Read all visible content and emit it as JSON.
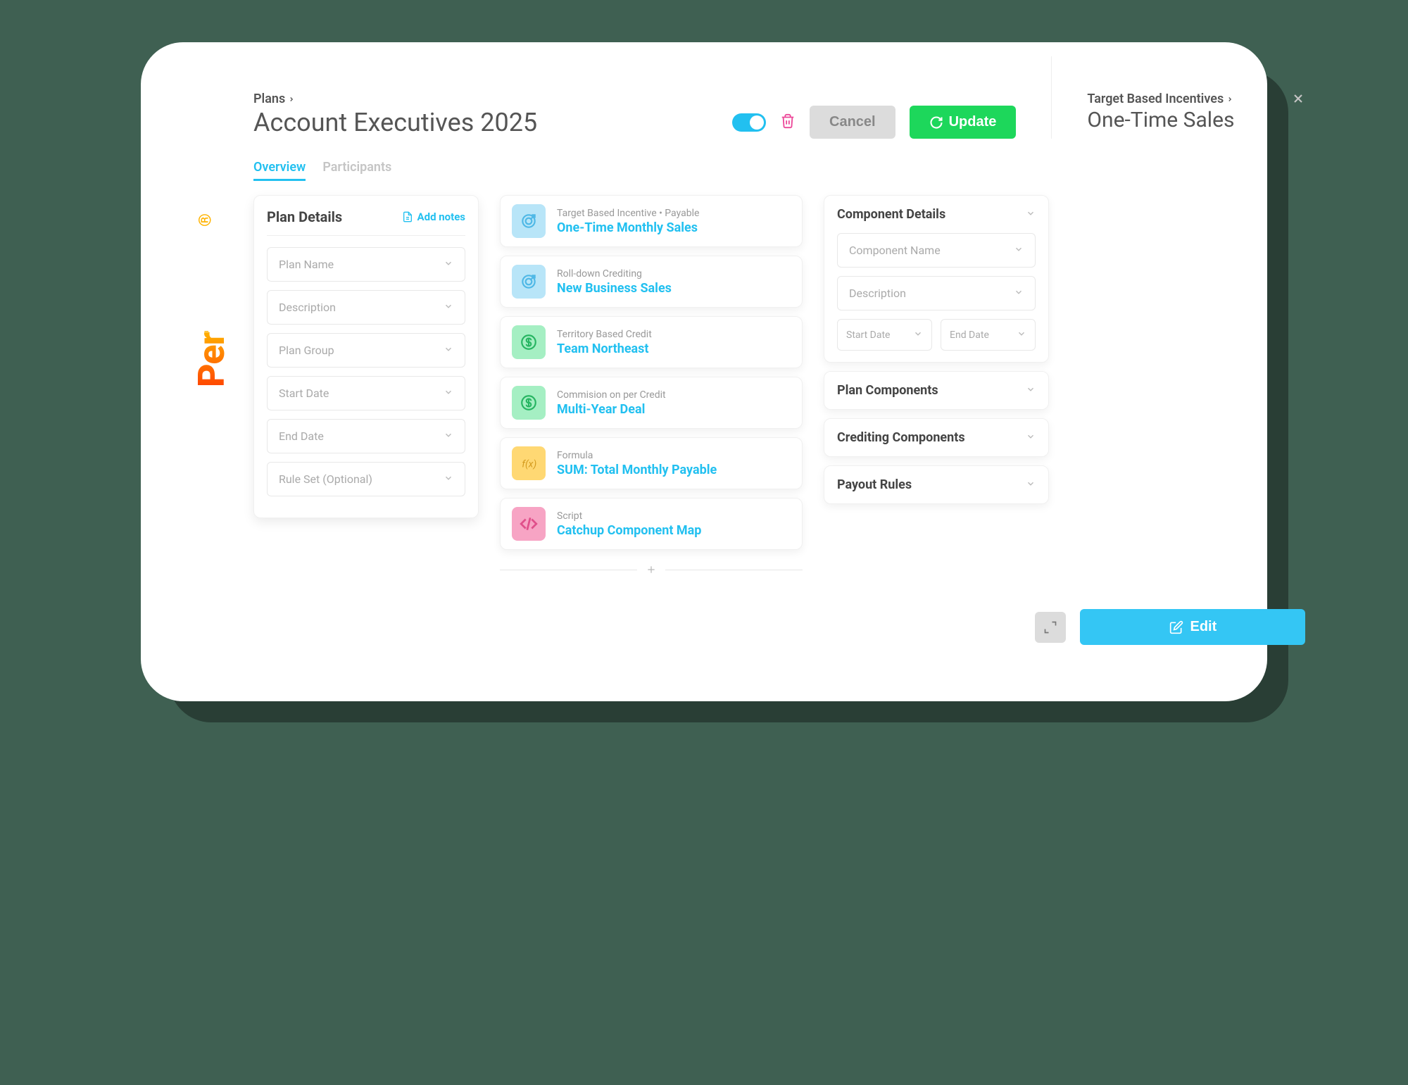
{
  "brand": "Performio",
  "breadcrumb": {
    "root": "Plans"
  },
  "title": "Account Executives 2025",
  "actions": {
    "cancel": "Cancel",
    "update": "Update"
  },
  "tabs": [
    {
      "label": "Overview",
      "active": true
    },
    {
      "label": "Participants",
      "active": false
    }
  ],
  "planDetails": {
    "heading": "Plan Details",
    "addNotes": "Add notes",
    "fields": [
      {
        "label": "Plan Name",
        "optional": ""
      },
      {
        "label": "Description",
        "optional": ""
      },
      {
        "label": "Plan Group",
        "optional": ""
      },
      {
        "label": "Start Date",
        "optional": ""
      },
      {
        "label": "End Date",
        "optional": ""
      },
      {
        "label": "Rule Set",
        "optional": "(Optional)"
      }
    ]
  },
  "components": [
    {
      "meta": "Target Based Incentive • Payable",
      "name": "One-Time Monthly Sales",
      "icon": "target",
      "bg": "bg-blue"
    },
    {
      "meta": "Roll-down Crediting",
      "name": "New Business Sales",
      "icon": "target",
      "bg": "bg-blue"
    },
    {
      "meta": "Territory Based Credit",
      "name": "Team Northeast",
      "icon": "dollar",
      "bg": "bg-green"
    },
    {
      "meta": "Commision on per Credit",
      "name": "Multi-Year Deal",
      "icon": "dollar",
      "bg": "bg-green"
    },
    {
      "meta": "Formula",
      "name": "SUM: Total Monthly Payable",
      "icon": "fx",
      "bg": "bg-yellow"
    },
    {
      "meta": "Script",
      "name": "Catchup Component Map",
      "icon": "code",
      "bg": "bg-pink"
    }
  ],
  "rightPanel": {
    "crumb": "Target Based Incentives",
    "title": "One-Time Sales",
    "sections": {
      "details": {
        "heading": "Component Details",
        "fields": [
          {
            "label": "Component Name"
          },
          {
            "label": "Description"
          }
        ],
        "dates": {
          "start": "Start Date",
          "end": "End Date"
        }
      },
      "planComponents": "Plan Components",
      "crediting": "Crediting Components",
      "payout": "Payout Rules"
    }
  },
  "bottom": {
    "edit": "Edit"
  }
}
